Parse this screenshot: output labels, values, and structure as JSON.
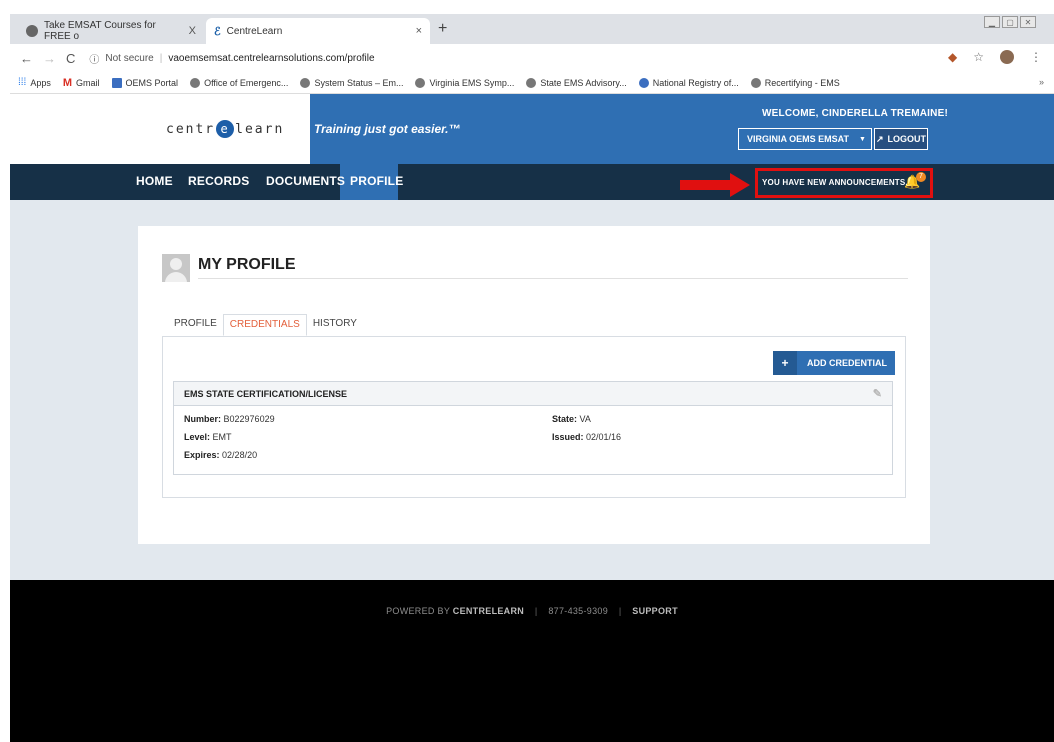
{
  "browser": {
    "tabs": [
      {
        "title": "Take EMSAT Courses for FREE o",
        "close": "X"
      },
      {
        "title": "CentreLearn",
        "close": "×"
      }
    ],
    "new_tab": "+",
    "security": "Not secure",
    "url": "vaoemsemsat.centrelearnsolutions.com/profile",
    "bookmarks": [
      "Apps",
      "Gmail",
      "OEMS Portal",
      "Office of Emergenc...",
      "System Status – Em...",
      "Virginia EMS Symp...",
      "State EMS Advisory...",
      "National Registry of...",
      "Recertifying - EMS"
    ],
    "bookmarks_overflow": "»"
  },
  "header": {
    "logo_left": "centr",
    "logo_e": "e",
    "logo_right": "learn",
    "tagline": "Training just got easier.™",
    "welcome": "WELCOME, CINDERELLA TREMAINE!",
    "account": "VIRGINIA OEMS EMSAT",
    "logout": "LOGOUT"
  },
  "nav": {
    "items": [
      "HOME",
      "RECORDS",
      "DOCUMENTS",
      "PROFILE"
    ],
    "active": "PROFILE",
    "announcement": "YOU HAVE NEW ANNOUNCEMENTS.",
    "announcement_count": "7"
  },
  "profile": {
    "title": "MY PROFILE",
    "tabs": [
      "PROFILE",
      "CREDENTIALS",
      "HISTORY"
    ],
    "active_tab": "CREDENTIALS",
    "add_button": "ADD CREDENTIAL",
    "credential": {
      "heading": "EMS STATE CERTIFICATION/LICENSE",
      "number_label": "Number:",
      "number": "B022976029",
      "level_label": "Level:",
      "level": "EMT",
      "expires_label": "Expires:",
      "expires": "02/28/20",
      "state_label": "State:",
      "state": "VA",
      "issued_label": "Issued:",
      "issued": "02/01/16"
    }
  },
  "footer": {
    "powered_by": "POWERED BY",
    "brand": "CENTRELEARN",
    "phone": "877-435-9309",
    "support": "SUPPORT"
  },
  "colors": {
    "header_blue": "#2f6fb3",
    "nav_dark": "#163047",
    "accent_orange": "#e3603c",
    "annotation_red": "#e01010"
  }
}
